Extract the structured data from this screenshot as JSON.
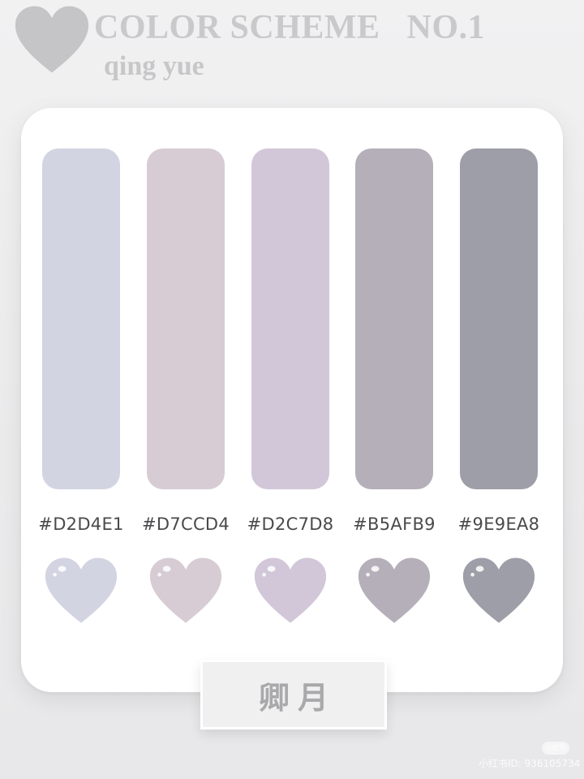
{
  "header": {
    "title": "COLOR SCHEME   NO.1",
    "subtitle": "qing yue",
    "heart_color": "#c5c5c7"
  },
  "palette": [
    {
      "hex": "#D2D4E1",
      "color": "#D2D4E1"
    },
    {
      "hex": "#D7CCD4",
      "color": "#D7CCD4"
    },
    {
      "hex": "#D2C7D8",
      "color": "#D2C7D8"
    },
    {
      "hex": "#B5AFB9",
      "color": "#B5AFB9"
    },
    {
      "hex": "#9E9EA8",
      "color": "#9E9EA8"
    }
  ],
  "name_label": "卿月",
  "watermark": {
    "badge": "小红书",
    "text": "小红书ID: 936105734"
  }
}
